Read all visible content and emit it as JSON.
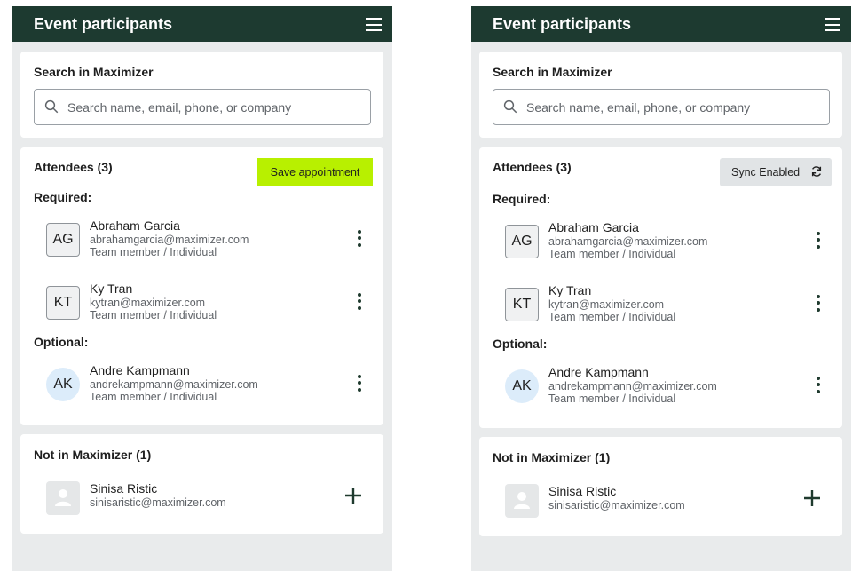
{
  "app": {
    "title": "Event participants",
    "search_section_title": "Search in Maximizer",
    "search_placeholder": "Search name, email, phone, or company",
    "attendees_title": "Attendees (3)",
    "required_label": "Required:",
    "optional_label": "Optional:",
    "not_in_title": "Not in Maximizer (1)"
  },
  "left_panel": {
    "action_label": "Save appointment"
  },
  "right_panel": {
    "action_label": "Sync Enabled"
  },
  "required_attendees": [
    {
      "initials": "AG",
      "name": "Abraham Garcia",
      "email": "abrahamgarcia@maximizer.com",
      "role": "Team member / Individual"
    },
    {
      "initials": "KT",
      "name": "Ky Tran",
      "email": "kytran@maximizer.com",
      "role": "Team member / Individual"
    }
  ],
  "optional_attendees": [
    {
      "initials": "AK",
      "name": "Andre Kampmann",
      "email": "andrekampmann@maximizer.com",
      "role": "Team member / Individual"
    }
  ],
  "not_in_maximizer": [
    {
      "name": "Sinisa Ristic",
      "email": "sinisaristic@maximizer.com"
    }
  ],
  "colors": {
    "header_bg": "#1d3a30",
    "save_button_bg": "#b8f000",
    "sync_button_bg": "#e1e4e6",
    "avatar_round_bg": "#dcecfa"
  }
}
